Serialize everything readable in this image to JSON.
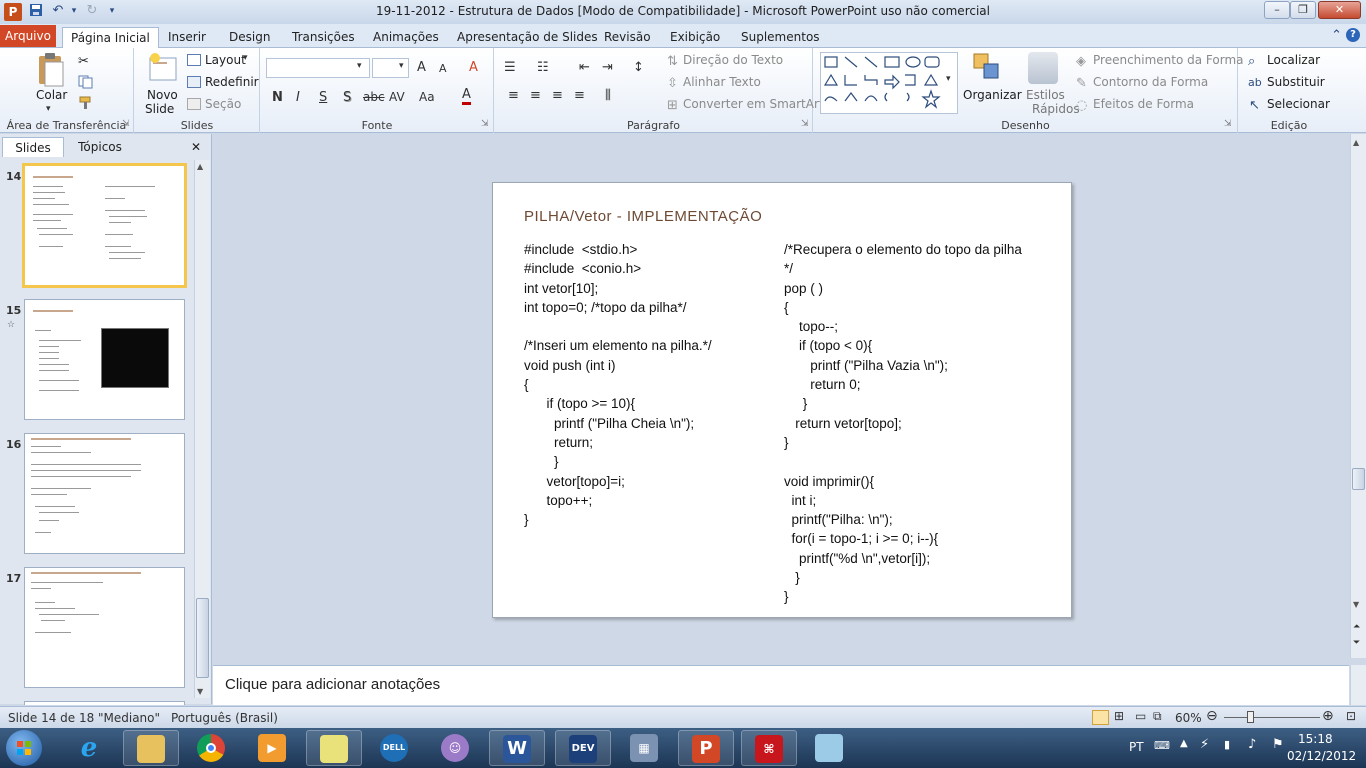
{
  "window": {
    "title": "19-11-2012 - Estrutura de Dados [Modo de Compatibilidade] - Microsoft PowerPoint uso não comercial",
    "app_icon": "P",
    "controls": {
      "minimize": "–",
      "restore": "❐",
      "close": "✕"
    }
  },
  "tabs": {
    "file": "Arquivo",
    "items": [
      "Página Inicial",
      "Inserir",
      "Design",
      "Transições",
      "Animações",
      "Apresentação de Slides",
      "Revisão",
      "Exibição",
      "Suplementos"
    ],
    "active": "Página Inicial"
  },
  "ribbon": {
    "clipboard": {
      "label": "Área de Transferência",
      "paste": "Colar"
    },
    "slides": {
      "label": "Slides",
      "new_slide_1": "Novo",
      "new_slide_2": "Slide",
      "layout": "Layout",
      "reset": "Redefinir",
      "section": "Seção"
    },
    "font": {
      "label": "Fonte",
      "buttons": {
        "bold": "N",
        "italic": "I",
        "underline": "S",
        "shadow": "S",
        "strike": "abc",
        "spacing": "AV",
        "case": "Aa",
        "grow": "A",
        "shrink": "A",
        "clear": "A",
        "color": "A"
      }
    },
    "paragraph": {
      "label": "Parágrafo",
      "direction": "Direção do Texto",
      "align": "Alinhar Texto",
      "smartart": "Converter em SmartArt"
    },
    "drawing": {
      "label": "Desenho",
      "arrange": "Organizar",
      "quick_styles_1": "Estilos",
      "quick_styles_2": "Rápidos",
      "fill": "Preenchimento da Forma",
      "outline": "Contorno da Forma",
      "effects": "Efeitos de Forma"
    },
    "editing": {
      "label": "Edição",
      "find": "Localizar",
      "replace": "Substituir",
      "select": "Selecionar"
    }
  },
  "panel": {
    "tabs": [
      "Slides",
      "Tópicos"
    ],
    "close": "✕",
    "thumbnails": [
      {
        "number": "14",
        "selected": true
      },
      {
        "number": "15",
        "selected": false
      },
      {
        "number": "16",
        "selected": false
      },
      {
        "number": "17",
        "selected": false
      }
    ]
  },
  "slide": {
    "title": "PILHA/Vetor - IMPLEMENTAÇÃO",
    "left_code": [
      "#include  <stdio.h>",
      "#include  <conio.h>",
      "int vetor[10];",
      "int topo=0; /*topo da pilha*/",
      "",
      "/*Inseri um elemento na pilha.*/",
      "void push (int i)",
      "{",
      "      if (topo >= 10){",
      "        printf (\"Pilha Cheia \\n\");",
      "        return;",
      "        }",
      "      vetor[topo]=i;",
      "      topo++;",
      "}"
    ],
    "right_code": [
      "/*Recupera o elemento do topo da pilha",
      "*/",
      "pop ( )",
      "{",
      "    topo--;",
      "    if (topo < 0){",
      "       printf (\"Pilha Vazia \\n\");",
      "       return 0;",
      "     }",
      "   return vetor[topo];",
      "}",
      "",
      "void imprimir(){",
      "  int i;",
      "  printf(\"Pilha: \\n\");",
      "  for(i = topo-1; i >= 0; i--){",
      "    printf(\"%d \\n\",vetor[i]);",
      "   }",
      "}"
    ]
  },
  "notes": {
    "placeholder": "Clique para adicionar anotações"
  },
  "status": {
    "slide_info": "Slide 14 de 18",
    "theme": "\"Mediano\"",
    "language": "Português (Brasil)",
    "zoom": "60%"
  },
  "taskbar": {
    "apps": [
      "start",
      "internet-explorer",
      "explorer",
      "chrome",
      "media-player",
      "sticky-notes",
      "dell",
      "messenger",
      "word",
      "dev-cpp",
      "calculator",
      "powerpoint",
      "acrobat",
      "paint"
    ],
    "dev_label": "DEV",
    "dell_label": "DELL",
    "language": "PT",
    "time": "15:18",
    "date": "02/12/2012"
  },
  "colors": {
    "file_tab": "#d24726",
    "title_accent": "#6e4a35",
    "selection": "#f4c64b",
    "taskbar": "#1c3554"
  }
}
